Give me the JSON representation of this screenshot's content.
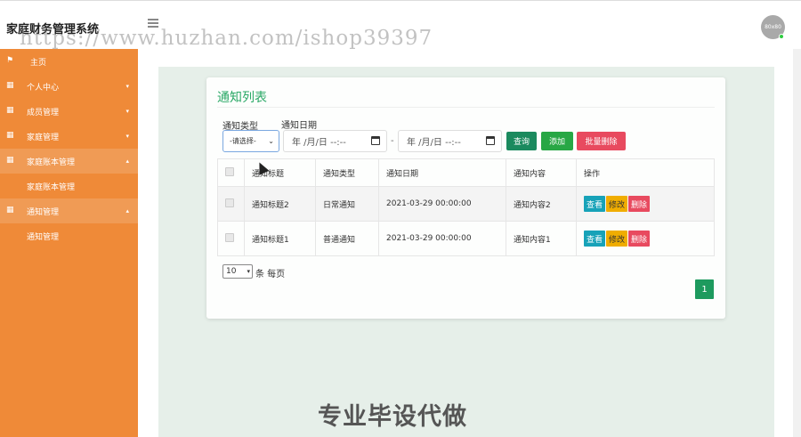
{
  "header": {
    "app_title": "家庭财务管理系统",
    "avatar_text": "80x80",
    "watermark": "https://www.huzhan.com/ishop39397"
  },
  "sidebar": {
    "items": [
      {
        "label": "主页",
        "icon": "flag-icon"
      },
      {
        "label": "个人中心",
        "icon": "grid-icon"
      },
      {
        "label": "成员管理",
        "icon": "grid-icon"
      },
      {
        "label": "家庭管理",
        "icon": "grid-icon"
      },
      {
        "label": "家庭账本管理",
        "icon": "grid-icon",
        "sub": "家庭账本管理"
      },
      {
        "label": "通知管理",
        "icon": "grid-icon",
        "sub": "通知管理"
      }
    ]
  },
  "card": {
    "title": "通知列表",
    "filters": {
      "type_label": "通知类型",
      "date_label": "通知日期",
      "select_value": "-请选择-",
      "date_placeholder": "年 /月/日 --:--",
      "range_separator": "-"
    },
    "buttons": {
      "search": "查询",
      "add": "添加",
      "batch_delete": "批量删除"
    },
    "table": {
      "headers": [
        "通知标题",
        "通知类型",
        "通知日期",
        "通知内容",
        "操作"
      ],
      "rows": [
        {
          "title": "通知标题2",
          "type": "日常通知",
          "date": "2021-03-29 00:00:00",
          "content": "通知内容2"
        },
        {
          "title": "通知标题1",
          "type": "普通通知",
          "date": "2021-03-29 00:00:00",
          "content": "通知内容1"
        }
      ],
      "actions": {
        "view": "查看",
        "edit": "修改",
        "delete": "删除"
      }
    },
    "pagination": {
      "page_size": "10",
      "page_size_suffix": "条 每页",
      "current_page": "1"
    }
  },
  "promo_text": "专业毕设代做",
  "colors": {
    "sidebar": "#ef8a38",
    "accent": "#2aa866",
    "search_button": "#1b8a5e",
    "add_button": "#28a745",
    "delete_button": "#e84a5f",
    "view_button": "#17a2b8",
    "edit_button": "#f0ad00"
  }
}
